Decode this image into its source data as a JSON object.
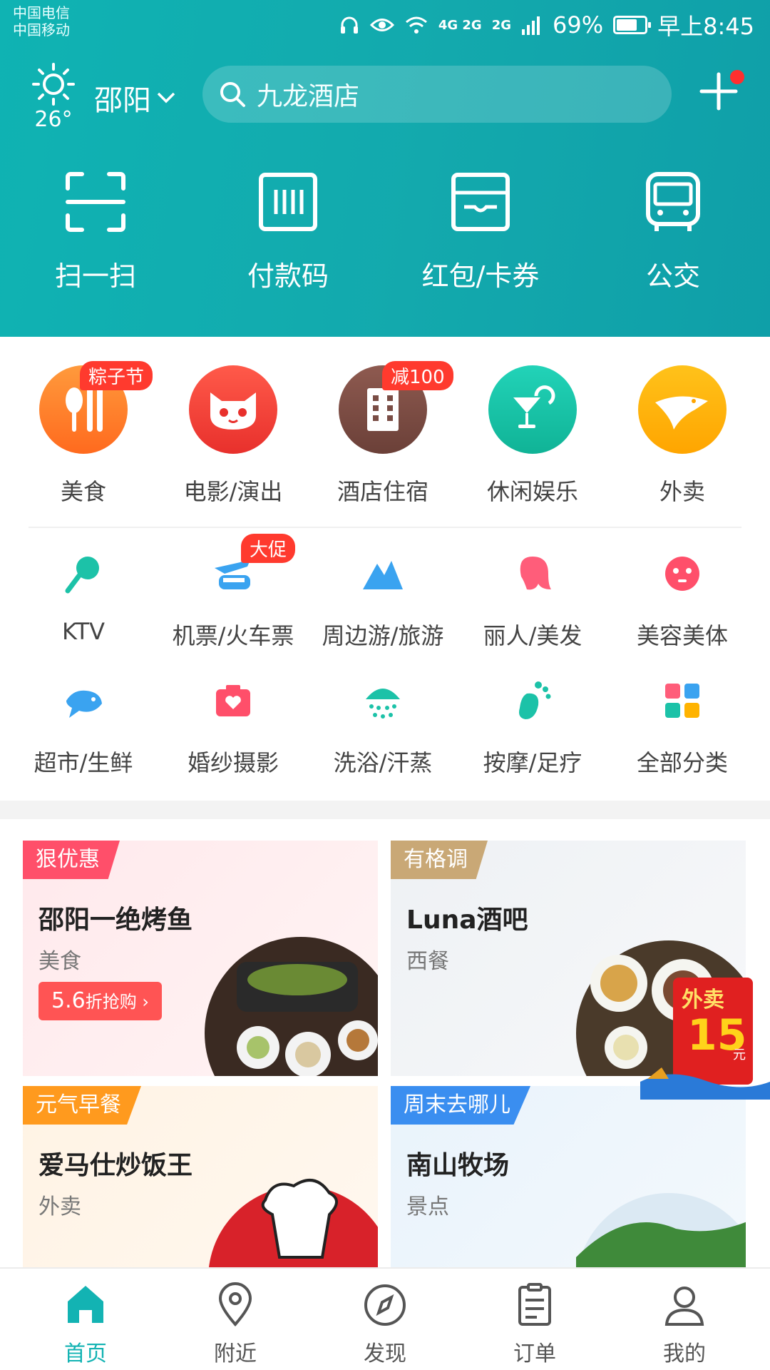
{
  "status": {
    "carrier1": "中国电信",
    "carrier2": "中国移动",
    "net1": "4G 2G",
    "net2": "2G",
    "battery": "69%",
    "time": "早上8:45"
  },
  "header": {
    "temperature": "26°",
    "city": "邵阳",
    "search_placeholder": "九龙酒店"
  },
  "quick_actions": [
    {
      "label": "扫一扫",
      "icon": "scan-icon"
    },
    {
      "label": "付款码",
      "icon": "barcode-icon"
    },
    {
      "label": "红包/卡券",
      "icon": "coupon-icon"
    },
    {
      "label": "公交",
      "icon": "bus-icon"
    }
  ],
  "main_categories": [
    {
      "label": "美食",
      "badge": "粽子节",
      "color": "#ff7a2e"
    },
    {
      "label": "电影/演出",
      "badge": "",
      "color": "#f2403a"
    },
    {
      "label": "酒店住宿",
      "badge": "减100",
      "color": "#7a4d45"
    },
    {
      "label": "休闲娱乐",
      "badge": "",
      "color": "#14c2a6"
    },
    {
      "label": "外卖",
      "badge": "",
      "color": "#ffb300"
    }
  ],
  "sub_categories_row1": [
    {
      "label": "KTV",
      "badge": ""
    },
    {
      "label": "机票/火车票",
      "badge": "大促"
    },
    {
      "label": "周边游/旅游",
      "badge": ""
    },
    {
      "label": "丽人/美发",
      "badge": ""
    },
    {
      "label": "美容美体",
      "badge": ""
    }
  ],
  "sub_categories_row2": [
    {
      "label": "超市/生鲜"
    },
    {
      "label": "婚纱摄影"
    },
    {
      "label": "洗浴/汗蒸"
    },
    {
      "label": "按摩/足疗"
    },
    {
      "label": "全部分类"
    }
  ],
  "cards": [
    {
      "tag": "狠优惠",
      "title": "邵阳一绝烤鱼",
      "subtitle": "美食",
      "button_value": "5.6",
      "button_text": "折抢购 ›"
    },
    {
      "tag": "有格调",
      "title": "Luna酒吧",
      "subtitle": "西餐"
    },
    {
      "tag": "元气早餐",
      "title": "爱马仕炒饭王",
      "subtitle": "外卖"
    },
    {
      "tag": "周末去哪儿",
      "title": "南山牧场",
      "subtitle": "景点"
    }
  ],
  "promo": {
    "line1": "外卖",
    "amount": "15",
    "unit": "元"
  },
  "tabs": [
    {
      "label": "首页",
      "active": true
    },
    {
      "label": "附近",
      "active": false
    },
    {
      "label": "发现",
      "active": false
    },
    {
      "label": "订单",
      "active": false
    },
    {
      "label": "我的",
      "active": false
    }
  ],
  "colors": {
    "brand": "#13b3b3",
    "badge": "#ff3a2e"
  }
}
